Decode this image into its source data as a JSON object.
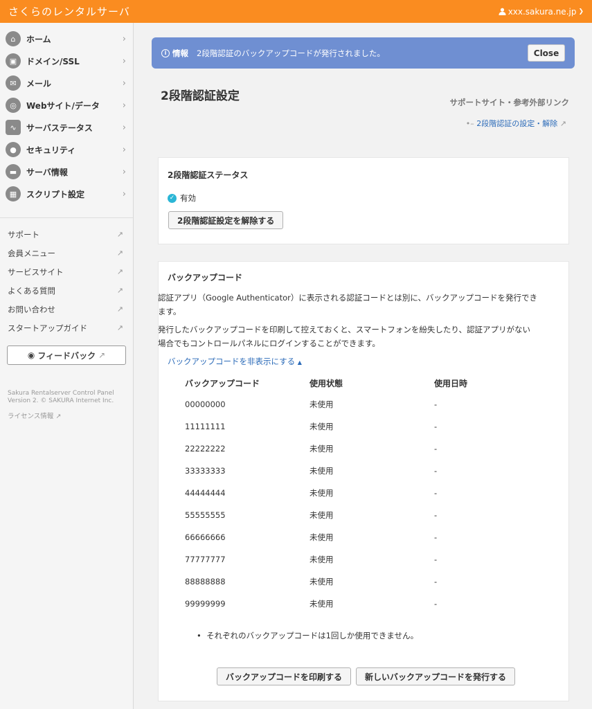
{
  "header": {
    "brand": "さくらのレンタルサーバ",
    "user": "xxx.sakura.ne.jp"
  },
  "sidebar": {
    "items": [
      {
        "label": "ホーム",
        "icon": "home-icon"
      },
      {
        "label": "ドメイン/SSL",
        "icon": "lock-domain-icon"
      },
      {
        "label": "メール",
        "icon": "mail-icon"
      },
      {
        "label": "Webサイト/データ",
        "icon": "globe-icon"
      },
      {
        "label": "サーバステータス",
        "icon": "chart-icon"
      },
      {
        "label": "セキュリティ",
        "icon": "lock-icon"
      },
      {
        "label": "サーバ情報",
        "icon": "server-icon"
      },
      {
        "label": "スクリプト設定",
        "icon": "script-icon"
      }
    ],
    "links": [
      "サポート",
      "会員メニュー",
      "サービスサイト",
      "よくある質問",
      "お問い合わせ",
      "スタートアップガイド"
    ],
    "feedback": "フィードバック",
    "copyright_line1": "Sakura Rentalserver Control Panel",
    "copyright_line2": "Version 2. © SAKURA Internet Inc.",
    "license": "ライセンス情報"
  },
  "alert": {
    "label": "情報",
    "message": "2段階認証のバックアップコードが発行されました。",
    "close": "Close"
  },
  "page": {
    "title": "2段階認証設定",
    "support_heading": "サポートサイト・参考外部リンク",
    "support_link": "2段階認証の設定・解除"
  },
  "status_card": {
    "title": "2段階認証ステータス",
    "status": "有効",
    "disable_button": "2段階認証設定を解除する"
  },
  "backup_card": {
    "title": "バックアップコード",
    "desc1_line1": "認証アプリ（Google Authenticator）に表示される認証コードとは別に、バックアップコードを発行でき",
    "desc1_line2": "ます。",
    "desc2_line1": "発行したバックアップコードを印刷して控えておくと、スマートフォンを紛失したり、認証アプリがない",
    "desc2_line2": "場合でもコントロールパネルにログインすることができます。",
    "toggle": "バックアップコードを非表示にする",
    "columns": [
      "バックアップコード",
      "使用状態",
      "使用日時"
    ],
    "rows": [
      [
        "00000000",
        "未使用",
        "-"
      ],
      [
        "11111111",
        "未使用",
        "-"
      ],
      [
        "22222222",
        "未使用",
        "-"
      ],
      [
        "33333333",
        "未使用",
        "-"
      ],
      [
        "44444444",
        "未使用",
        "-"
      ],
      [
        "55555555",
        "未使用",
        "-"
      ],
      [
        "66666666",
        "未使用",
        "-"
      ],
      [
        "77777777",
        "未使用",
        "-"
      ],
      [
        "88888888",
        "未使用",
        "-"
      ],
      [
        "99999999",
        "未使用",
        "-"
      ]
    ],
    "note": "それぞれのバックアップコードは1回しか使用できません。",
    "print_button": "バックアップコードを印刷する",
    "issue_button": "新しいバックアップコードを発行する"
  },
  "colors": {
    "header": "#fa8c20",
    "alert": "#6f8fd2",
    "link": "#2a6ab8",
    "check": "#2bb6d6"
  }
}
